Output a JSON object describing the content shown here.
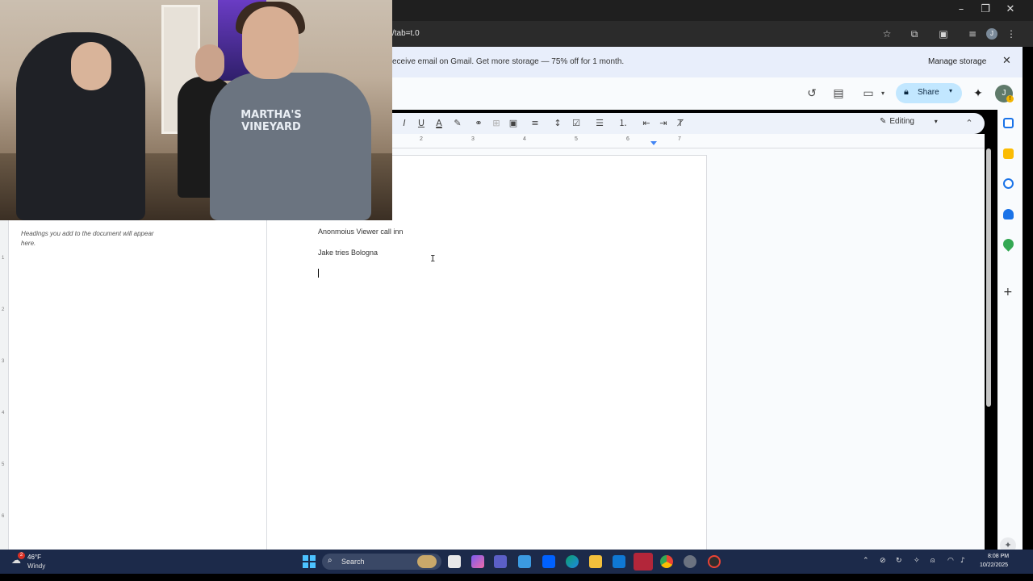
{
  "browser": {
    "url_fragment": "/tab=t.0",
    "window_controls": [
      "–",
      "❐",
      "✕"
    ]
  },
  "banner": {
    "text": "eceive email on Gmail. Get more storage — 75% off for 1 month.",
    "manage_label": "Manage storage",
    "close": "✕"
  },
  "header": {
    "share_label": "Share",
    "avatar_letter": "J",
    "avatar_badge": "!"
  },
  "toolbar": {
    "editing_label": "Editing"
  },
  "ruler": {
    "numbers": [
      "2",
      "3",
      "4",
      "5",
      "6",
      "7"
    ]
  },
  "vertical_ruler": {
    "numbers": [
      "1",
      "2",
      "3",
      "4",
      "5",
      "6"
    ]
  },
  "outline": {
    "hint": "Headings you add to the document will appear here."
  },
  "document": {
    "lines": [
      "Anonmoius Viewer call inn",
      "Jake tries Bologna"
    ]
  },
  "webcam": {
    "shirt_text": "MARTHA'S VINEYARD"
  },
  "taskbar": {
    "weather_temp": "46°F",
    "weather_desc": "Windy",
    "weather_badge": "2",
    "search_label": "Search",
    "clock_time": "8:08 PM",
    "clock_date": "10/22/2025"
  },
  "colors": {
    "share_bg": "#c2e7ff",
    "banner_bg": "#e8eefb",
    "taskbar_bg": "#1c2a4a",
    "accent_blue": "#4285f4"
  }
}
